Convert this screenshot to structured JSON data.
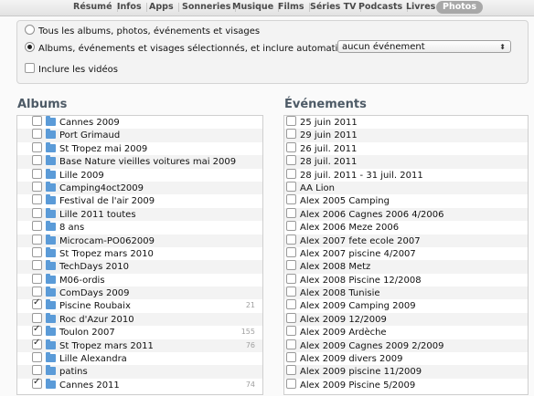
{
  "tabs": [
    {
      "label": "Résumé",
      "active": false
    },
    {
      "label": "Infos",
      "active": false
    },
    {
      "label": "Apps",
      "active": false
    },
    {
      "label": "Sonneries",
      "active": false
    },
    {
      "label": "Musique",
      "active": false
    },
    {
      "label": "Films",
      "active": false
    },
    {
      "label": "Séries TV",
      "active": false
    },
    {
      "label": "Podcasts",
      "active": false
    },
    {
      "label": "Livres",
      "active": false
    },
    {
      "label": "Photos",
      "active": true
    }
  ],
  "options": {
    "all_label": "Tous les albums, photos, événements et visages",
    "selected_label": "Albums, événements et visages sélectionnés, et inclure automatiquement",
    "auto_include_value": "aucun événement",
    "include_videos_label": "Inclure les vidéos"
  },
  "albums": {
    "title": "Albums",
    "items": [
      {
        "label": "Cannes 2009",
        "checked": false,
        "count": ""
      },
      {
        "label": "Port Grimaud",
        "checked": false,
        "count": ""
      },
      {
        "label": "St Tropez mai 2009",
        "checked": false,
        "count": ""
      },
      {
        "label": "Base Nature vieilles voitures mai 2009",
        "checked": false,
        "count": ""
      },
      {
        "label": "Lille 2009",
        "checked": false,
        "count": ""
      },
      {
        "label": "Camping4oct2009",
        "checked": false,
        "count": ""
      },
      {
        "label": "Festival de l'air 2009",
        "checked": false,
        "count": ""
      },
      {
        "label": "Lille 2011 toutes",
        "checked": false,
        "count": ""
      },
      {
        "label": "8 ans",
        "checked": false,
        "count": ""
      },
      {
        "label": "Microcam-PO062009",
        "checked": false,
        "count": ""
      },
      {
        "label": "St Tropez mars 2010",
        "checked": false,
        "count": ""
      },
      {
        "label": "TechDays 2010",
        "checked": false,
        "count": ""
      },
      {
        "label": "M06-ordis",
        "checked": false,
        "count": ""
      },
      {
        "label": "ComDays 2009",
        "checked": false,
        "count": ""
      },
      {
        "label": "Piscine Roubaix",
        "checked": true,
        "count": "21"
      },
      {
        "label": "Roc d'Azur 2010",
        "checked": false,
        "count": ""
      },
      {
        "label": "Toulon 2007",
        "checked": true,
        "count": "155"
      },
      {
        "label": "St Tropez mars 2011",
        "checked": true,
        "count": "76"
      },
      {
        "label": "Lille Alexandra",
        "checked": false,
        "count": ""
      },
      {
        "label": "patins",
        "checked": false,
        "count": ""
      },
      {
        "label": "Cannes 2011",
        "checked": true,
        "count": "74"
      }
    ]
  },
  "events": {
    "title": "Événements",
    "items": [
      {
        "label": "25 juin 2011",
        "checked": false
      },
      {
        "label": "29 juin 2011",
        "checked": false
      },
      {
        "label": "26 juil. 2011",
        "checked": false
      },
      {
        "label": "28 juil. 2011",
        "checked": false
      },
      {
        "label": "28 juil. 2011 - 31 juil. 2011",
        "checked": false
      },
      {
        "label": "AA Lion",
        "checked": false
      },
      {
        "label": "Alex 2005 Camping",
        "checked": false
      },
      {
        "label": "Alex 2006 Cagnes 2006 4/2006",
        "checked": false
      },
      {
        "label": "Alex 2006 Meze 2006",
        "checked": false
      },
      {
        "label": "Alex 2007 fete ecole 2007",
        "checked": false
      },
      {
        "label": "Alex 2007 piscine 4/2007",
        "checked": false
      },
      {
        "label": "Alex 2008 Metz",
        "checked": false
      },
      {
        "label": "Alex 2008 Piscine 12/2008",
        "checked": false
      },
      {
        "label": "Alex 2008 Tunisie",
        "checked": false
      },
      {
        "label": "Alex 2009  Camping 2009",
        "checked": false
      },
      {
        "label": "Alex 2009 12/2009",
        "checked": false
      },
      {
        "label": "Alex 2009 Ardèche",
        "checked": false
      },
      {
        "label": "Alex 2009 Cagnes 2009  2/2009",
        "checked": false
      },
      {
        "label": "Alex 2009 divers 2009",
        "checked": false
      },
      {
        "label": "Alex 2009 piscine 11/2009",
        "checked": false
      },
      {
        "label": "Alex 2009 Piscine 5/2009",
        "checked": false
      }
    ]
  }
}
